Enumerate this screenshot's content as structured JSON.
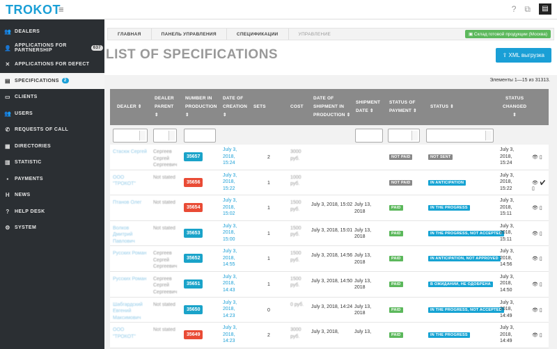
{
  "app": {
    "logo": "TROKOT"
  },
  "sidebar": {
    "items": [
      {
        "label": "DEALERS",
        "icon": "users-icon"
      },
      {
        "label": "APPLICATIONS FOR PARTNERSHIP",
        "icon": "user-plus-icon",
        "badge": "637"
      },
      {
        "label": "APPLICATIONS FOR DEFECT",
        "icon": "close-icon"
      },
      {
        "label": "SPECIFICATIONS",
        "icon": "file-icon",
        "badge": "2"
      },
      {
        "label": "CLIENTS",
        "icon": "card-icon"
      },
      {
        "label": "USERS",
        "icon": "users-icon"
      },
      {
        "label": "REQUESTS OF CALL",
        "icon": "phone-icon"
      },
      {
        "label": "DIRECTORIES",
        "icon": "folder-icon"
      },
      {
        "label": "STATISTIC",
        "icon": "chart-icon"
      },
      {
        "label": "PAYMENTS",
        "icon": "money-icon"
      },
      {
        "label": "NEWS",
        "icon": "h-icon"
      },
      {
        "label": "HELP DESK",
        "icon": "question-icon"
      },
      {
        "label": "SYSTEM",
        "icon": "gears-icon"
      }
    ]
  },
  "breadcrumb": [
    "ГЛАВНАЯ",
    "ПАНЕЛЬ УПРАВЛЕНИЯ",
    "СПЕЦИФИКАЦИИ",
    "УПРАВЛЕНИЕ"
  ],
  "warehouse_button": "Склад готовой продукции (Москва)",
  "page_title": "LIST OF SPECIFICATIONS",
  "xml_button": "XML выгрузка",
  "summary": "Элементы 1—15 из 31313.",
  "columns": [
    {
      "label": "DEALER ⇕"
    },
    {
      "label": "DEALER PARENT ⇕"
    },
    {
      "label": "NUMBER IN PRODUCTION ⇕"
    },
    {
      "label": "DATE OF CREATION ⇕"
    },
    {
      "label": "SETS"
    },
    {
      "label": "COST"
    },
    {
      "label": "DATE OF SHIPMENT IN PRODUCTION ⇕"
    },
    {
      "label": "SHIPMENT DATE ⇕"
    },
    {
      "label": "STATUS OF PAYMENT ⇕"
    },
    {
      "label": "STATUS ⇕"
    },
    {
      "label": "STATUS CHANGED ⇕"
    }
  ],
  "rows": [
    {
      "dealer": "Стасюк Сергей",
      "parent": "Сергеев Сергей Сергеевич",
      "number": "35657",
      "num_color": "blue",
      "created": [
        "July 3,",
        "2018,",
        "15:24"
      ],
      "sets": "2",
      "cost": "3000 руб.",
      "ship_prod": "",
      "ship": "",
      "payment": "NOT PAID",
      "pay_color": "gray",
      "status": "NOT SENT",
      "status_color": "gray",
      "changed": [
        "July 3,",
        "2018,",
        "15:24"
      ],
      "actions": "👁 ▯"
    },
    {
      "dealer": "ООО \"ТРОКОТ\"",
      "parent": "Not stated",
      "number": "35656",
      "num_color": "red",
      "created": [
        "July 3,",
        "2018,",
        "15:22"
      ],
      "sets": "1",
      "cost": "1000 руб.",
      "ship_prod": "",
      "ship": "",
      "payment": "NOT PAID",
      "pay_color": "gray",
      "status": "IN ANTICIPATION",
      "status_color": "blue",
      "changed": [
        "July 3,",
        "2018,",
        "15:22"
      ],
      "actions": "👁 ✔ ▯"
    },
    {
      "dealer": "Птанов Олег",
      "parent": "Not stated",
      "number": "35654",
      "num_color": "red",
      "created": [
        "July 3,",
        "2018,",
        "15:02"
      ],
      "sets": "1",
      "cost": "1500 руб.",
      "ship_prod": "July 3, 2018, 15:02",
      "ship": "July 13, 2018",
      "payment": "PAID",
      "pay_color": "green",
      "status": "IN THE PROGRESS",
      "status_color": "blue",
      "changed": [
        "July 3,",
        "2018,",
        "15:11"
      ],
      "actions": "👁 ▯"
    },
    {
      "dealer": "Волков Дмитрий Павлович",
      "parent": "Not stated",
      "number": "35653",
      "num_color": "blue",
      "created": [
        "July 3,",
        "2018,",
        "15:00"
      ],
      "sets": "1",
      "cost": "1500 руб.",
      "ship_prod": "July 3, 2018, 15:01",
      "ship": "July 13, 2018",
      "payment": "PAID",
      "pay_color": "green",
      "status": "IN THE PROGRESS, NOT ACCEPTED",
      "status_color": "blue",
      "changed": [
        "July 3,",
        "2018,",
        "15:11"
      ],
      "actions": "👁 ▯"
    },
    {
      "dealer": "Русских Роман",
      "parent": "Сергеев Сергей Сергеевич",
      "number": "35652",
      "num_color": "blue",
      "created": [
        "July 3,",
        "2018,",
        "14:55"
      ],
      "sets": "1",
      "cost": "1500 руб.",
      "ship_prod": "July 3, 2018, 14:56",
      "ship": "July 13, 2018",
      "payment": "PAID",
      "pay_color": "green",
      "status": "IN ANTICIPATION, NOT APPROVED",
      "status_color": "blue",
      "changed": [
        "July 3,",
        "2018,",
        "14:56"
      ],
      "actions": "👁 ▯"
    },
    {
      "dealer": "Русских Роман",
      "parent": "Сергеев Сергей Сергеевич",
      "number": "35651",
      "num_color": "blue",
      "created": [
        "July 3,",
        "2018,",
        "14:43"
      ],
      "sets": "1",
      "cost": "1500 руб.",
      "ship_prod": "July 3, 2018, 14:50",
      "ship": "July 13, 2018",
      "payment": "PAID",
      "pay_color": "green",
      "status": "В ОЖИДАНИИ, НЕ ОДОБРЕНА",
      "status_color": "blue",
      "changed": [
        "July 3,",
        "2018,",
        "14:50"
      ],
      "actions": "👁 ▯"
    },
    {
      "dealer": "Шабгардский Евгений Максимович",
      "parent": "Not stated",
      "number": "35650",
      "num_color": "blue",
      "created": [
        "July 3,",
        "2018,",
        "14:23"
      ],
      "sets": "0",
      "cost": "0 руб.",
      "ship_prod": "July 3, 2018, 14:24",
      "ship": "July 13, 2018",
      "payment": "PAID",
      "pay_color": "green",
      "status": "IN THE PROGRESS, NOT ACCEPTED",
      "status_color": "blue",
      "changed": [
        "July 3,",
        "2018,",
        "14:49"
      ],
      "actions": "👁 ▯"
    },
    {
      "dealer": "ООО \"ТРОКОТ\"",
      "parent": "Not stated",
      "number": "35649",
      "num_color": "red",
      "created": [
        "July 3,",
        "2018,",
        "14:23"
      ],
      "sets": "2",
      "cost": "3000 руб.",
      "ship_prod": "July 3, 2018,",
      "ship": "July 13,",
      "payment": "PAID",
      "pay_color": "green",
      "status": "IN THE PROGRESS",
      "status_color": "blue",
      "changed": [
        "July 3,",
        "2018,",
        "14:49"
      ],
      "actions": "👁 ▯"
    }
  ]
}
